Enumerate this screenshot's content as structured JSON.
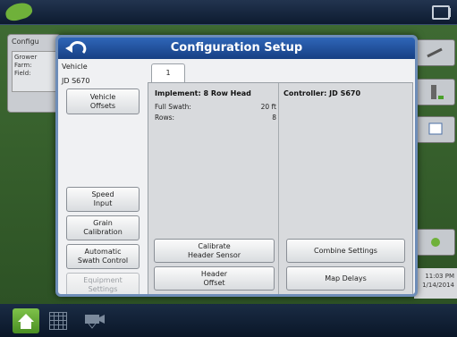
{
  "background": {
    "config_title": "Configu",
    "config_rows": [
      "Grower",
      "Farm:",
      "Field:"
    ],
    "time": "11:03 PM",
    "date": "1/14/2014"
  },
  "dialog": {
    "title": "Configuration Setup",
    "vehicle_label": "Vehicle",
    "vehicle_name": "JD S670",
    "buttons": {
      "vehicle_offsets": "Vehicle\nOffsets",
      "speed_input": "Speed\nInput",
      "grain_calibration": "Grain\nCalibration",
      "automatic_swath_control": "Automatic\nSwath Control",
      "equipment_settings": "Equipment\nSettings",
      "calibrate_header_sensor": "Calibrate\nHeader Sensor",
      "header_offset": "Header\nOffset",
      "combine_settings": "Combine Settings",
      "map_delays": "Map Delays"
    },
    "tab_label": "1",
    "implement": {
      "heading": "Implement: 8 Row Head",
      "full_swath_label": "Full Swath:",
      "full_swath_value": "20 ft",
      "rows_label": "Rows:",
      "rows_value": "8"
    },
    "controller": {
      "heading": "Controller: JD S670"
    }
  },
  "colors": {
    "title_bar": "#2f66b8",
    "accent_green": "#6fb13a"
  }
}
